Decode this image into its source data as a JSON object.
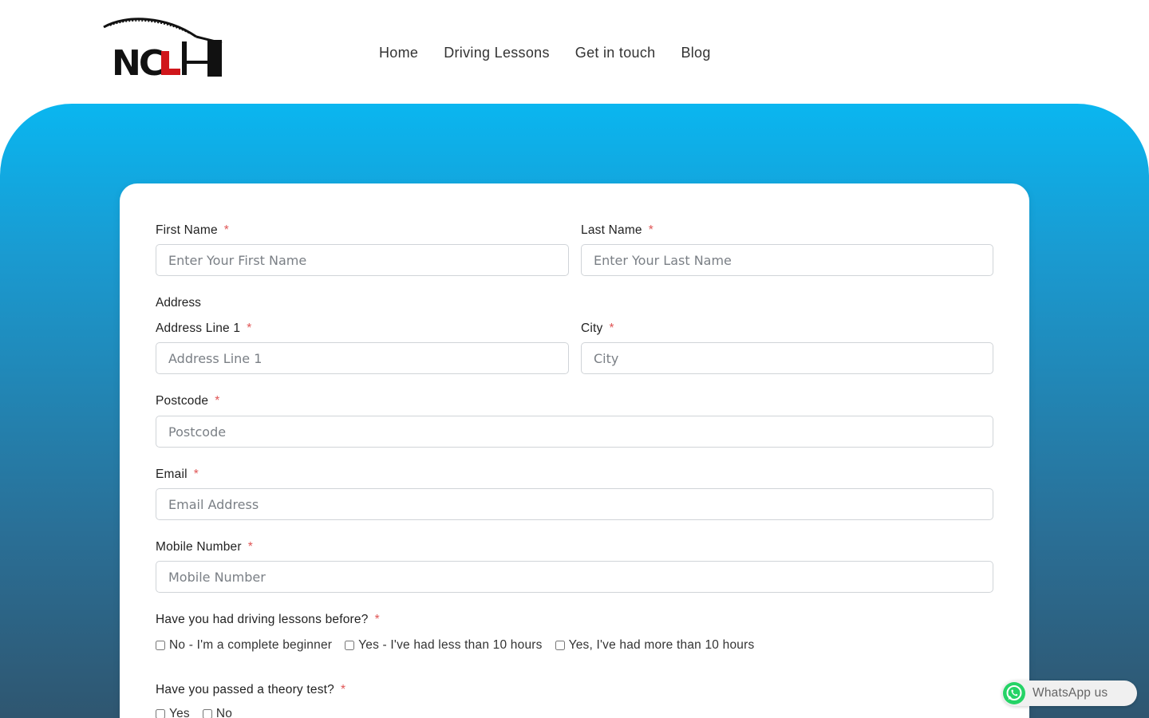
{
  "brand": {
    "logo_text": "NCL"
  },
  "nav": {
    "items": [
      "Home",
      "Driving Lessons",
      "Get in touch",
      "Blog"
    ]
  },
  "form": {
    "required_mark": "*",
    "first_name": {
      "label": "First Name",
      "placeholder": "Enter Your First Name"
    },
    "last_name": {
      "label": "Last Name",
      "placeholder": "Enter Your Last Name"
    },
    "address_section": "Address",
    "address_line1": {
      "label": "Address Line 1",
      "placeholder": "Address Line 1"
    },
    "city": {
      "label": "City",
      "placeholder": "City"
    },
    "postcode": {
      "label": "Postcode",
      "placeholder": "Postcode"
    },
    "email": {
      "label": "Email",
      "placeholder": "Email Address"
    },
    "mobile": {
      "label": "Mobile Number",
      "placeholder": "Mobile Number"
    },
    "lessons_before": {
      "label": "Have you had driving lessons before?",
      "options": [
        "No - I'm a complete beginner",
        "Yes - I've had less than 10 hours",
        "Yes, I've had more than 10 hours"
      ]
    },
    "theory_test": {
      "label": "Have you passed a theory test?",
      "options": [
        "Yes",
        "No"
      ]
    }
  },
  "whatsapp": {
    "label": "WhatsApp us"
  },
  "colors": {
    "accent": "#0ab6f0",
    "required": "#e05555",
    "whatsapp": "#25d366",
    "logo_red": "#d0161b"
  }
}
